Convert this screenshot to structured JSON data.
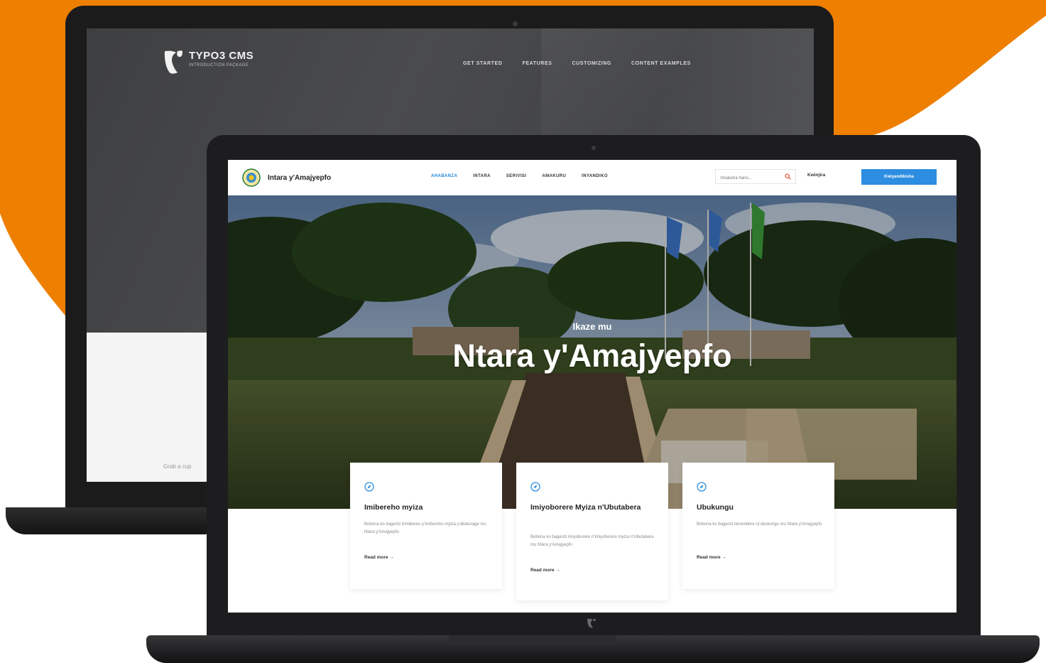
{
  "colors": {
    "accent_orange": "#ee7f00",
    "brand_blue": "#2d8de0",
    "dark_bezel": "#1d1d1f"
  },
  "back_site": {
    "logo_title": "TYPO3 CMS",
    "logo_subtitle": "INTRODUCTION PACKAGE",
    "nav": [
      "GET STARTED",
      "FEATURES",
      "CUSTOMIZING",
      "CONTENT EXAMPLES"
    ],
    "caption": "Grab a cup"
  },
  "front_site": {
    "site_name": "Intara y'Amajyepfo",
    "nav": [
      {
        "label": "AHABANZA",
        "active": true
      },
      {
        "label": "INTARA",
        "active": false
      },
      {
        "label": "SERIVISI",
        "active": false
      },
      {
        "label": "AMAKURU",
        "active": false
      },
      {
        "label": "INYANDIKO",
        "active": false
      }
    ],
    "search_placeholder": "Shakisha hano...",
    "login_label": "Kwinjira",
    "register_label": "Kwiyandikisha",
    "hero_kicker": "Ikaze mu",
    "hero_title": "Ntara y'Amajyepfo",
    "cards": [
      {
        "icon": "compass-icon",
        "title": "Imibereho myiza",
        "text": "Bobona ko bagenzi bimibereo y'imibereho myiza y'abaturage mu Ntara y'Amajyepfo",
        "link": "Read more →"
      },
      {
        "icon": "compass-icon",
        "title": "Imiyoborere Myiza n'Ubutabera",
        "text": "Bobona ko bagenzi imiyoborere n'imiyoborere myiza n'Ubutabera mu Ntara y'Amajyepfo",
        "link": "Read more →"
      },
      {
        "icon": "compass-icon",
        "title": "Ubukungu",
        "text": "Bobona ko bagenzi iterambere ry'ubukungu mu Ntara y'Amajyepfo",
        "link": "Read more →"
      }
    ]
  }
}
